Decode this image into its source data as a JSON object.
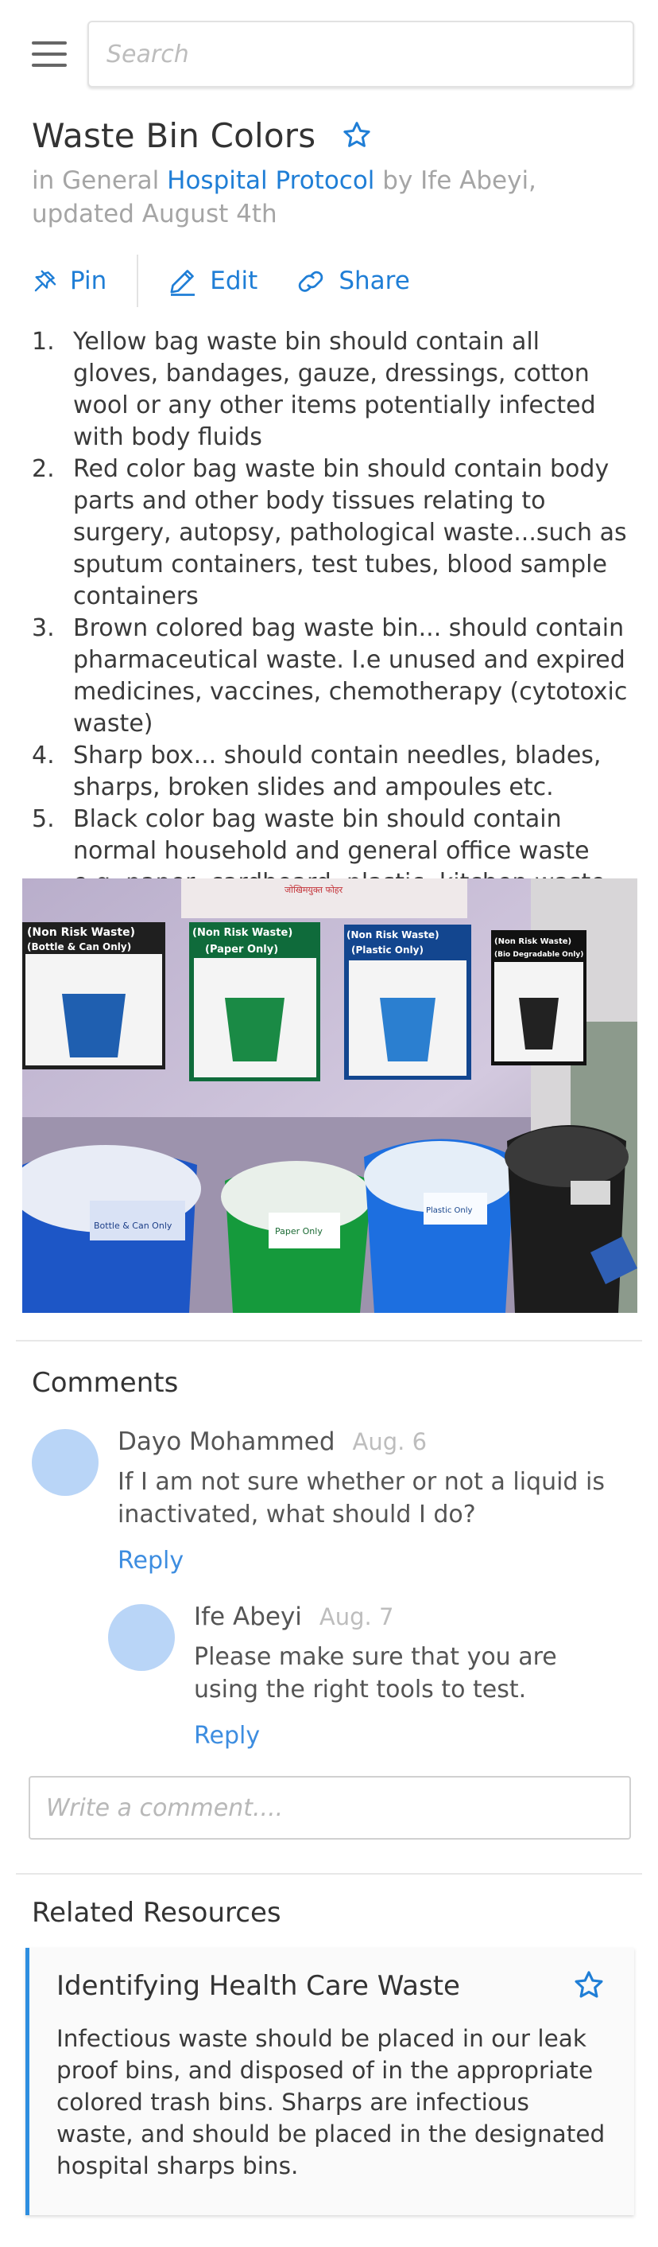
{
  "search": {
    "placeholder": "Search"
  },
  "article": {
    "title": "Waste Bin Colors",
    "meta_prefix": "in General",
    "meta_collection": "Hospital Protocol",
    "meta_author_line": "by Ife Abeyi,",
    "meta_updated": "updated August 4th"
  },
  "actions": {
    "pin": "Pin",
    "edit": "Edit",
    "share": "Share"
  },
  "steps": [
    {
      "num": "1.",
      "text": "Yellow bag waste bin should contain all gloves, bandages, gauze, dressings, cotton wool or any other items potentially infected with body fluids"
    },
    {
      "num": "2.",
      "text": "Red color bag waste bin should contain body parts and other body tissues relating to surgery, autopsy, pathological waste...such as sputum containers, test tubes, blood sample containers"
    },
    {
      "num": "3.",
      "text": "Brown colored bag waste bin... should contain pharmaceutical waste. I.e unused and expired medicines, vaccines, chemotherapy (cytotoxic waste)"
    },
    {
      "num": "4.",
      "text": "Sharp box... should contain needles, blades, sharps, broken slides and ampoules etc."
    },
    {
      "num": "5.",
      "text": "Black color bag waste bin should contain normal household and general office waste e.g. paper, cardboard, plastic, kitchen waste."
    }
  ],
  "photo": {
    "signs": [
      "(Non Risk Waste)",
      "(Non Risk Waste)",
      "(Non Risk Waste)",
      "(Non Risk Waste)"
    ],
    "sign_subs": [
      "(Bottle & Can Only)",
      "(Paper Only)",
      "(Plastic Only)",
      "(Bio Degradable Only)"
    ],
    "bin_labels": [
      "Bottle & Can Only",
      "Paper Only",
      "Plastic Only",
      ""
    ]
  },
  "comments": {
    "title": "Comments",
    "items": [
      {
        "name": "Dayo Mohammed",
        "date": "Aug. 6",
        "text": "If I am not sure whether or not a liquid is inactivated, what should I do?",
        "reply": "Reply"
      },
      {
        "name": "Ife Abeyi",
        "date": "Aug. 7",
        "text": "Please make sure that you are using the right tools to test.",
        "reply": "Reply"
      }
    ],
    "input_placeholder": "Write a comment...."
  },
  "related": {
    "title": "Related Resources",
    "card_title": "Identifying Health Care Waste",
    "card_text": "Infectious waste should be placed in our leak proof bins, and disposed of in the appropriate colored trash bins. Sharps are infectious waste, and should be placed in the designated hospital sharps bins."
  },
  "colors": {
    "accent": "#1f7ed6",
    "avatar": "#b9d5f7",
    "card_border": "#2e8ee0"
  },
  "icons": [
    "menu-icon",
    "star-outline-icon",
    "pin-icon",
    "pencil-icon",
    "link-icon"
  ]
}
